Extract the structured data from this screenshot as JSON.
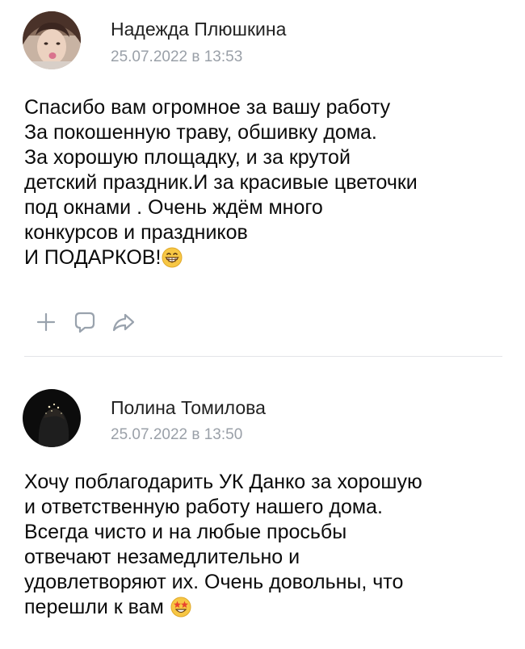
{
  "posts": [
    {
      "author": "Надежда Плюшкина",
      "timestamp": "25.07.2022 в 13:53",
      "lines": [
        "Спасибо вам огромное за вашу работу",
        "За покошенную траву, обшивку дома.",
        "За хорошую площадку, и за крутой",
        "детский праздник.И за красивые цветочки",
        "под окнами . Очень ждём много",
        "конкурсов и праздников",
        "И ПОДАРКОВ!"
      ],
      "emoji": "grinning-face-emoji",
      "actions": [
        "plus-icon",
        "comment-icon",
        "share-icon"
      ]
    },
    {
      "author": "Полина Томилова",
      "timestamp": "25.07.2022 в 13:50",
      "lines": [
        "Хочу поблагодарить УК Данко за хорошую",
        "и ответственную работу нашего дома.",
        "Всегда чисто и на любые просьбы",
        "отвечают незамедлительно и",
        "удовлетворяют их. Очень довольны, что",
        "перешли к вам"
      ],
      "emoji": "star-struck-emoji"
    }
  ],
  "colors": {
    "author": "#222222",
    "timestamp": "#9aa0a8",
    "icon": "#99a2ad",
    "divider": "#e3e4e8"
  }
}
